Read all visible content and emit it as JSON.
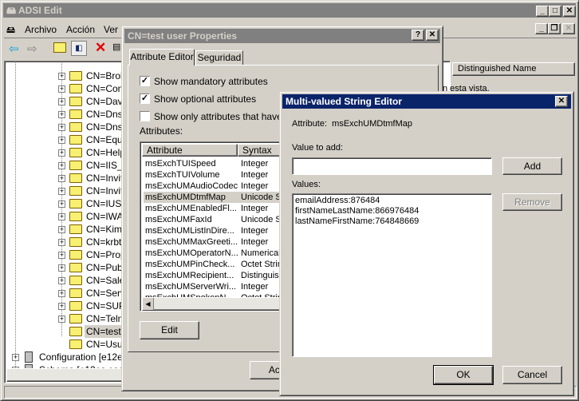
{
  "main": {
    "title": "ADSI Edit",
    "menu": [
      "Archivo",
      "Acción",
      "Ver"
    ],
    "toolbar": [
      "back-icon",
      "forward-icon",
      "up-folder-icon",
      "show-tree-icon",
      "delete-icon",
      "properties-icon"
    ],
    "tree": [
      "CN=Broke",
      "CN=Cont",
      "CN=Davic",
      "CN=DnsA",
      "CN=DnsU",
      "CN=Equip",
      "CN=HelpS",
      "CN=IIS_V",
      "CN=Invit",
      "CN=Invit",
      "CN=IUSR",
      "CN=IWAN",
      "CN=Kim A",
      "CN=krbtg",
      "CN=Propi",
      "CN=Publi",
      "CN=Sales",
      "CN=Servi",
      "CN=SUPP",
      "CN=Telne",
      "CN=test u",
      "CN=Usua"
    ],
    "tree_roots": [
      "Configuration [e12es",
      "Schema [e12es.esexc"
    ],
    "selected_item": "CN=test u",
    "list_header": "Distinguished Name",
    "list_empty": "n esta vista."
  },
  "props": {
    "title": "CN=test user Properties",
    "tabs": [
      "Attribute Editor",
      "Seguridad"
    ],
    "checks": [
      {
        "label": "Show mandatory attributes",
        "checked": true
      },
      {
        "label": "Show optional attributes",
        "checked": true
      },
      {
        "label": "Show only attributes that have va",
        "checked": false
      }
    ],
    "attributes_label": "Attributes:",
    "columns": [
      "Attribute",
      "Syntax"
    ],
    "rows": [
      [
        "msExchTUISpeed",
        "Integer"
      ],
      [
        "msExchTUIVolume",
        "Integer"
      ],
      [
        "msExchUMAudioCodec",
        "Integer"
      ],
      [
        "msExchUMDtmfMap",
        "Unicode S"
      ],
      [
        "msExchUMEnabledFl...",
        "Integer"
      ],
      [
        "msExchUMFaxId",
        "Unicode S"
      ],
      [
        "msExchUMListInDire...",
        "Integer"
      ],
      [
        "msExchUMMaxGreeti...",
        "Integer"
      ],
      [
        "msExchUMOperatorN...",
        "Numerical"
      ],
      [
        "msExchUMPinCheck...",
        "Octet Strir"
      ],
      [
        "msExchUMRecipient...",
        "Distinguish"
      ],
      [
        "msExchUMServerWri...",
        "Integer"
      ],
      [
        "msExchUMSpokenN...",
        "Octet Strir"
      ]
    ],
    "edit": "Edit",
    "ok": "Acep"
  },
  "mv": {
    "title": "Multi-valued String Editor",
    "attribute_label": "Attribute:",
    "attribute": "msExchUMDtmfMap",
    "value_label": "Value to add:",
    "value": "",
    "values_label": "Values:",
    "values": [
      "emailAddress:876484",
      "firstNameLastName:866976484",
      "lastNameFirstName:764848669"
    ],
    "add": "Add",
    "remove": "Remove",
    "ok": "OK",
    "cancel": "Cancel"
  },
  "colors": {
    "active_title": "#0a246a",
    "inactive_title": "#808080",
    "face": "#d4d0c8"
  }
}
